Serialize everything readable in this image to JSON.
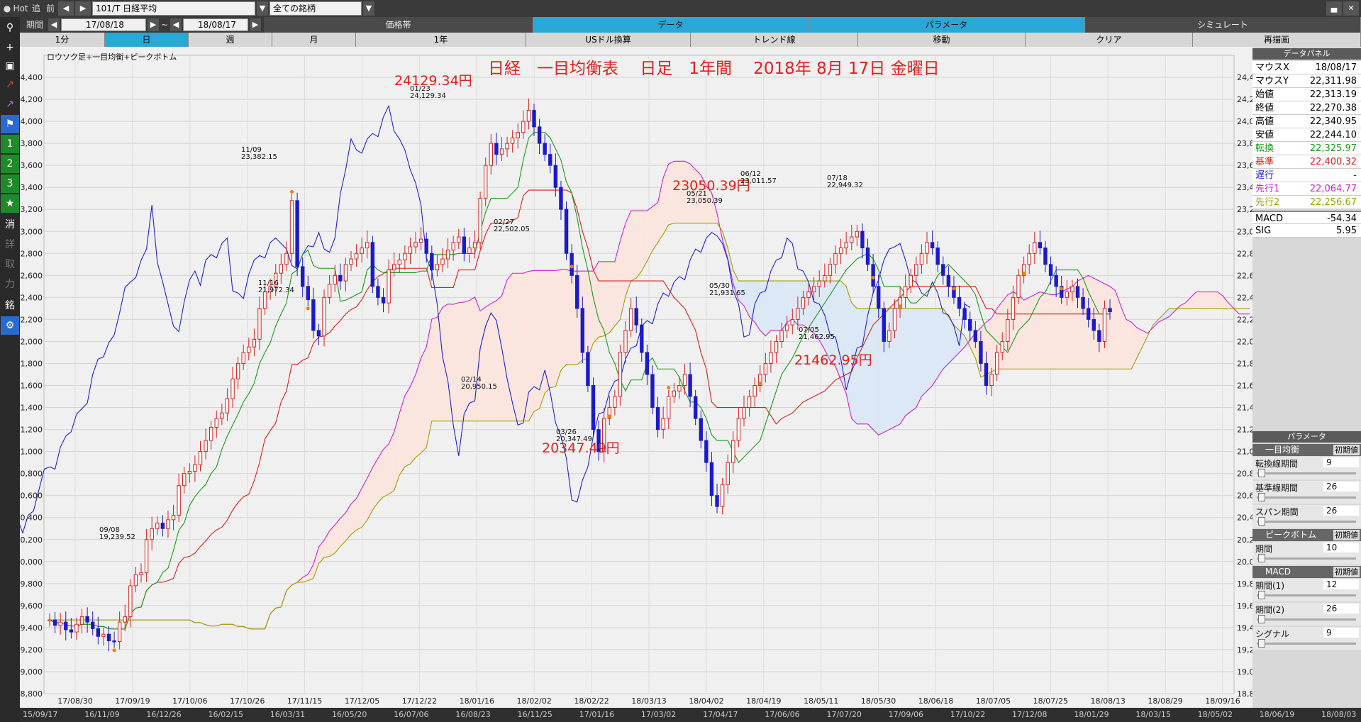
{
  "toolbar": {
    "hot_label": "Hot",
    "add_label": "追",
    "prev_label": "前",
    "symbol": "101/T 日経平均",
    "universe": "全ての銘柄"
  },
  "period_bar": {
    "period_label": "期間",
    "from_date": "17/08/18",
    "tilde": "~",
    "to_date": "18/08/17",
    "tabs": [
      "価格帯",
      "データ",
      "パラメータ",
      "シミュレート"
    ],
    "active_tab": "データ"
  },
  "interval_bar": {
    "items": [
      "1分",
      "日",
      "週",
      "月",
      "1年",
      "USドル換算",
      "トレンド線",
      "移動",
      "クリア",
      "再描画"
    ],
    "active": "日"
  },
  "chart": {
    "subtitle": "ロウソク足+一目均衡+ピークボトム",
    "headline": "日経　一目均衡表　 日足　1年間　 2018年 8月 17日 金曜日"
  },
  "annotations": [
    {
      "big": "24129.34円",
      "date": "01/23",
      "val": "24,129.34"
    },
    {
      "big": "23050.39円",
      "date": "05/21",
      "val": "23,050.39"
    },
    {
      "big": "20347.49円",
      "date": "03/26",
      "val": "20,347.49"
    },
    {
      "big": "21462.95円",
      "date": "07/05",
      "val": "21,462.95"
    },
    {
      "big": "",
      "date": "11/09",
      "val": "23,382.15"
    },
    {
      "big": "",
      "date": "11/16",
      "val": "21,972.34"
    },
    {
      "big": "",
      "date": "02/14",
      "val": "20,950.15"
    },
    {
      "big": "",
      "date": "02/27",
      "val": "22,502.05"
    },
    {
      "big": "",
      "date": "05/30",
      "val": "21,931.65"
    },
    {
      "big": "",
      "date": "06/12",
      "val": "23,011.57"
    },
    {
      "big": "",
      "date": "07/18",
      "val": "22,949.32"
    },
    {
      "big": "",
      "date": "09/08",
      "val": "19,239.52"
    }
  ],
  "data_panel": {
    "title": "データパネル",
    "rows": [
      {
        "k": "マウスX",
        "v": "18/08/17",
        "color": "#000000"
      },
      {
        "k": "マウスY",
        "v": "22,311.98",
        "color": "#000000"
      },
      {
        "k": "始値",
        "v": "22,313.19",
        "color": "#000000"
      },
      {
        "k": "終値",
        "v": "22,270.38",
        "color": "#000000"
      },
      {
        "k": "高値",
        "v": "22,340.95",
        "color": "#000000"
      },
      {
        "k": "安値",
        "v": "22,244.10",
        "color": "#000000"
      },
      {
        "k": "転換",
        "v": "22,325.97",
        "color": "#1a9a1a"
      },
      {
        "k": "基準",
        "v": "22,400.32",
        "color": "#d62020"
      },
      {
        "k": "遅行",
        "v": "-",
        "color": "#2222cc"
      },
      {
        "k": "先行1",
        "v": "22,064.77",
        "color": "#cc22cc"
      },
      {
        "k": "先行2",
        "v": "22,256.67",
        "color": "#a0a000"
      },
      {
        "k": "MACD",
        "v": "-54.34",
        "color": "#000000"
      },
      {
        "k": "SIG",
        "v": "5.95",
        "color": "#000000"
      }
    ]
  },
  "param_panel": {
    "title": "パラメータ",
    "sections": [
      {
        "name": "一目均衡",
        "reset": "初期値",
        "params": [
          {
            "label": "転換線期間",
            "value": "9"
          },
          {
            "label": "基準線期間",
            "value": "26"
          },
          {
            "label": "スパン期間",
            "value": "26"
          }
        ]
      },
      {
        "name": "ピークボトム",
        "reset": "初期値",
        "params": [
          {
            "label": "期間",
            "value": "10"
          }
        ]
      },
      {
        "name": "MACD",
        "reset": "初期値",
        "params": [
          {
            "label": "期間(1)",
            "value": "12"
          },
          {
            "label": "期間(2)",
            "value": "26"
          },
          {
            "label": "シグナル",
            "value": "9"
          }
        ]
      }
    ]
  },
  "colors": {
    "tenkan": "#1a9a1a",
    "kijun": "#d62020",
    "chikou": "#2222cc",
    "senkou1": "#cc22cc",
    "senkou2": "#a0a000",
    "up_candle": "#d62020",
    "down_candle": "#1a1acc",
    "cloud_up": "#fae6df",
    "cloud_down": "#dce8f5",
    "annotation": "#e02020"
  },
  "bottom_dates": [
    "15/09/17",
    "16/11/09",
    "16/12/26",
    "16/02/15",
    "16/03/31",
    "16/05/20",
    "16/07/06",
    "16/08/23",
    "16/11/25",
    "17/01/16",
    "17/03/02",
    "17/04/17",
    "17/06/06",
    "17/07/20",
    "17/09/06",
    "17/10/22",
    "17/12/08",
    "18/01/29",
    "18/03/15",
    "18/05/02",
    "18/06/19",
    "18/08/03"
  ],
  "chart_data": {
    "type": "candlestick-ichimoku",
    "title": "日経　一目均衡表　 日足　1年間　 2018年 8月 17日 金曜日",
    "ylim": [
      18800,
      24600
    ],
    "yticks": [
      18800,
      19000,
      19200,
      19400,
      19600,
      19800,
      20000,
      20200,
      20400,
      20600,
      20800,
      21000,
      21200,
      21400,
      21600,
      21800,
      22000,
      22200,
      22400,
      22600,
      22800,
      23000,
      23200,
      23400,
      23600,
      23800,
      24000,
      24200,
      24400
    ],
    "xticks": [
      "17/08/30",
      "17/09/19",
      "17/10/06",
      "17/10/26",
      "17/11/15",
      "17/12/05",
      "17/12/22",
      "18/01/16",
      "18/02/02",
      "18/02/22",
      "18/03/13",
      "18/04/02",
      "18/04/19",
      "18/05/11",
      "18/05/30",
      "18/06/18",
      "18/07/05",
      "18/07/25",
      "18/08/13",
      "18/08/29",
      "18/09/16"
    ],
    "series": [
      {
        "name": "終値",
        "values": [
          19470,
          19420,
          19450,
          19380,
          19360,
          19430,
          19500,
          19450,
          19390,
          19320,
          19340,
          19280,
          19274,
          19450,
          19500,
          19780,
          19880,
          19900,
          20200,
          20300,
          20350,
          20300,
          20380,
          20420,
          20690,
          20800,
          20820,
          20880,
          21000,
          21100,
          21220,
          21300,
          21350,
          21480,
          21660,
          21800,
          21900,
          21950,
          22020,
          22300,
          22450,
          22500,
          22620,
          22700,
          22800,
          23280,
          22680,
          22500,
          22380,
          22100,
          22050,
          22400,
          22520,
          22600,
          22550,
          22700,
          22750,
          22800,
          22850,
          22900,
          22500,
          22400,
          22350,
          22650,
          22700,
          22740,
          22800,
          22860,
          22900,
          22930,
          22800,
          22650,
          22700,
          22750,
          22830,
          22900,
          22950,
          22800,
          22850,
          22900,
          23300,
          23600,
          23800,
          23700,
          23750,
          23800,
          23850,
          23900,
          24000,
          24100,
          23950,
          23800,
          23700,
          23600,
          23400,
          23200,
          22800,
          22600,
          22300,
          21900,
          21600,
          21200,
          21000,
          21300,
          21400,
          21500,
          21900,
          22100,
          22300,
          22150,
          21900,
          21700,
          21400,
          21200,
          21300,
          21500,
          21550,
          21600,
          21700,
          21500,
          21300,
          21100,
          20900,
          20600,
          20500,
          20700,
          20900,
          21100,
          21300,
          21400,
          21500,
          21600,
          21700,
          21800,
          21900,
          22000,
          22100,
          22150,
          22200,
          22300,
          22400,
          22450,
          22500,
          22550,
          22600,
          22700,
          22800,
          22850,
          22900,
          22950,
          23000,
          22850,
          22700,
          22500,
          22300,
          22000,
          22100,
          22300,
          22400,
          22500,
          22600,
          22700,
          22800,
          22900,
          22850,
          22700,
          22600,
          22500,
          22400,
          22300,
          22200,
          22100,
          22000,
          21800,
          21600,
          21700,
          21900,
          22000,
          22200,
          22400,
          22600,
          22700,
          22800,
          22900,
          22850,
          22700,
          22600,
          22500,
          22400,
          22450,
          22500,
          22400,
          22300,
          22200,
          22100,
          22000,
          22300,
          22270
        ]
      },
      {
        "name": "転換",
        "values": []
      },
      {
        "name": "基準",
        "values": []
      },
      {
        "name": "遅行",
        "values": []
      },
      {
        "name": "先行1",
        "values": []
      },
      {
        "name": "先行2",
        "values": []
      }
    ]
  }
}
